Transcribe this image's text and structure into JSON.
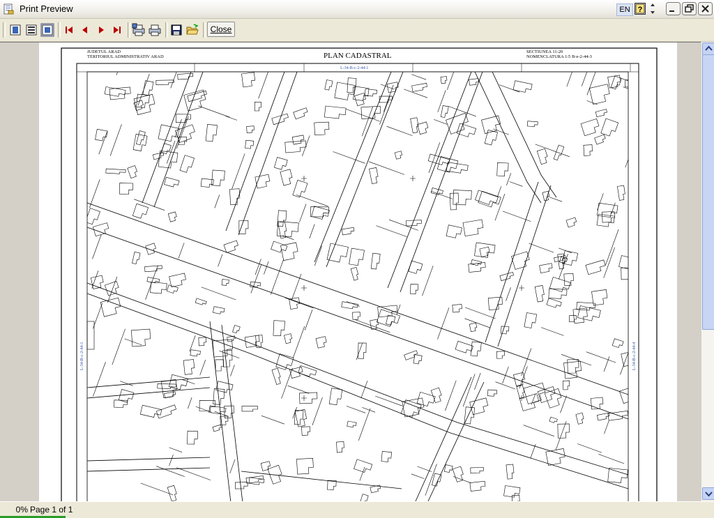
{
  "window": {
    "title": "Print Preview",
    "language": "EN",
    "help_label": "?"
  },
  "toolbar": {
    "buttons": [
      {
        "name": "single-page-view-icon"
      },
      {
        "name": "two-page-view-icon"
      },
      {
        "name": "fit-page-view-icon"
      },
      {
        "name": "first-page-icon"
      },
      {
        "name": "previous-page-icon"
      },
      {
        "name": "next-page-icon"
      },
      {
        "name": "last-page-icon"
      },
      {
        "name": "print-setup-icon"
      },
      {
        "name": "print-icon"
      },
      {
        "name": "save-icon"
      },
      {
        "name": "open-folder-icon"
      }
    ],
    "close_label": "Close"
  },
  "document": {
    "header_left_line1": "JUDETUL ARAD",
    "header_left_line2": "TERITORIUL ADMINISTRATIV ARAD",
    "header_center": "PLAN CADASTRAL",
    "header_right_line1": "SECTIUNEA 11-20",
    "header_right_line2": "NOMENCLATURA 1:5 B-e-2-44-3",
    "top_sheet_label": "L-34-B-c-2-44-1",
    "left_sheet_label": "L-34-B-c-2-44-1",
    "right_sheet_label": "L-34-B-c-2-44-4"
  },
  "status": {
    "zoom": "0%",
    "page": "Page 1 of 1"
  },
  "colors": {
    "accent": "#2a9c2a",
    "toolbar_bg": "#ece9d8",
    "viewport_bg": "#808080"
  }
}
